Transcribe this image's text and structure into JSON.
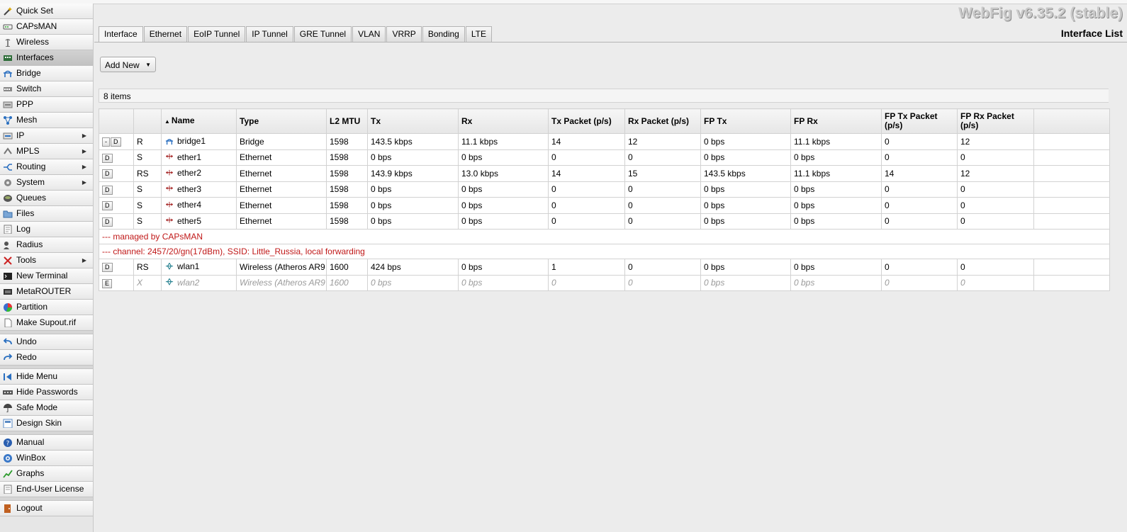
{
  "app": {
    "brand": "WebFig v6.35.2 (stable)",
    "page_title": "Interface List"
  },
  "sidebar": {
    "items": [
      {
        "label": "Quick Set",
        "icon": "wand-icon",
        "arrow": false
      },
      {
        "label": "CAPsMAN",
        "icon": "capsman-icon",
        "arrow": false
      },
      {
        "label": "Wireless",
        "icon": "antenna-icon",
        "arrow": false
      },
      {
        "label": "Interfaces",
        "icon": "interfaces-icon",
        "arrow": false
      },
      {
        "label": "Bridge",
        "icon": "bridge-icon",
        "arrow": false
      },
      {
        "label": "Switch",
        "icon": "switch-icon",
        "arrow": false
      },
      {
        "label": "PPP",
        "icon": "ppp-icon",
        "arrow": false
      },
      {
        "label": "Mesh",
        "icon": "mesh-icon",
        "arrow": false
      },
      {
        "label": "IP",
        "icon": "ip-icon",
        "arrow": true
      },
      {
        "label": "MPLS",
        "icon": "mpls-icon",
        "arrow": true
      },
      {
        "label": "Routing",
        "icon": "routing-icon",
        "arrow": true
      },
      {
        "label": "System",
        "icon": "gear-icon",
        "arrow": true
      },
      {
        "label": "Queues",
        "icon": "queues-icon",
        "arrow": false
      },
      {
        "label": "Files",
        "icon": "folder-icon",
        "arrow": false
      },
      {
        "label": "Log",
        "icon": "log-icon",
        "arrow": false
      },
      {
        "label": "Radius",
        "icon": "radius-icon",
        "arrow": false
      },
      {
        "label": "Tools",
        "icon": "tools-icon",
        "arrow": true
      },
      {
        "label": "New Terminal",
        "icon": "terminal-icon",
        "arrow": false
      },
      {
        "label": "MetaROUTER",
        "icon": "metarouter-icon",
        "arrow": false
      },
      {
        "label": "Partition",
        "icon": "partition-icon",
        "arrow": false
      },
      {
        "label": "Make Supout.rif",
        "icon": "document-icon",
        "arrow": false
      }
    ],
    "history": [
      {
        "label": "Undo",
        "icon": "undo-icon"
      },
      {
        "label": "Redo",
        "icon": "redo-icon"
      }
    ],
    "settings": [
      {
        "label": "Hide Menu",
        "icon": "hide-menu-icon"
      },
      {
        "label": "Hide Passwords",
        "icon": "password-dots-icon"
      },
      {
        "label": "Safe Mode",
        "icon": "umbrella-icon"
      },
      {
        "label": "Design Skin",
        "icon": "design-skin-icon"
      }
    ],
    "help": [
      {
        "label": "Manual",
        "icon": "help-icon"
      },
      {
        "label": "WinBox",
        "icon": "winbox-icon"
      },
      {
        "label": "Graphs",
        "icon": "graph-icon"
      },
      {
        "label": "End-User License",
        "icon": "license-icon"
      }
    ],
    "logout": {
      "label": "Logout",
      "icon": "logout-icon"
    }
  },
  "tabs": [
    "Interface",
    "Ethernet",
    "EoIP Tunnel",
    "IP Tunnel",
    "GRE Tunnel",
    "VLAN",
    "VRRP",
    "Bonding",
    "LTE"
  ],
  "toolbar": {
    "add_new_label": "Add New"
  },
  "list": {
    "count_text": "8 items",
    "columns": [
      "",
      "",
      "Name",
      "Type",
      "L2 MTU",
      "Tx",
      "Rx",
      "Tx Packet (p/s)",
      "Rx Packet (p/s)",
      "FP Tx",
      "FP Rx",
      "FP Tx Packet (p/s)",
      "FP Rx Packet (p/s)",
      ""
    ],
    "sorted_column": "Name",
    "rows": [
      {
        "kind": "data",
        "buttons": [
          "-",
          "D"
        ],
        "flags": "R",
        "icon": "bridge-icon",
        "name": "bridge1",
        "type": "Bridge",
        "l2mtu": "1598",
        "tx": "143.5 kbps",
        "rx": "11.1 kbps",
        "tx_pps": "14",
        "rx_pps": "12",
        "fp_tx": "0 bps",
        "fp_rx": "11.1 kbps",
        "fp_tx_pps": "0",
        "fp_rx_pps": "12"
      },
      {
        "kind": "data",
        "buttons": [
          "D"
        ],
        "flags": "S",
        "icon": "ethernet-icon",
        "name": "ether1",
        "type": "Ethernet",
        "l2mtu": "1598",
        "tx": "0 bps",
        "rx": "0 bps",
        "tx_pps": "0",
        "rx_pps": "0",
        "fp_tx": "0 bps",
        "fp_rx": "0 bps",
        "fp_tx_pps": "0",
        "fp_rx_pps": "0"
      },
      {
        "kind": "data",
        "buttons": [
          "D"
        ],
        "flags": "RS",
        "icon": "ethernet-icon",
        "name": "ether2",
        "type": "Ethernet",
        "l2mtu": "1598",
        "tx": "143.9 kbps",
        "rx": "13.0 kbps",
        "tx_pps": "14",
        "rx_pps": "15",
        "fp_tx": "143.5 kbps",
        "fp_rx": "11.1 kbps",
        "fp_tx_pps": "14",
        "fp_rx_pps": "12"
      },
      {
        "kind": "data",
        "buttons": [
          "D"
        ],
        "flags": "S",
        "icon": "ethernet-icon",
        "name": "ether3",
        "type": "Ethernet",
        "l2mtu": "1598",
        "tx": "0 bps",
        "rx": "0 bps",
        "tx_pps": "0",
        "rx_pps": "0",
        "fp_tx": "0 bps",
        "fp_rx": "0 bps",
        "fp_tx_pps": "0",
        "fp_rx_pps": "0"
      },
      {
        "kind": "data",
        "buttons": [
          "D"
        ],
        "flags": "S",
        "icon": "ethernet-icon",
        "name": "ether4",
        "type": "Ethernet",
        "l2mtu": "1598",
        "tx": "0 bps",
        "rx": "0 bps",
        "tx_pps": "0",
        "rx_pps": "0",
        "fp_tx": "0 bps",
        "fp_rx": "0 bps",
        "fp_tx_pps": "0",
        "fp_rx_pps": "0"
      },
      {
        "kind": "data",
        "buttons": [
          "D"
        ],
        "flags": "S",
        "icon": "ethernet-icon",
        "name": "ether5",
        "type": "Ethernet",
        "l2mtu": "1598",
        "tx": "0 bps",
        "rx": "0 bps",
        "tx_pps": "0",
        "rx_pps": "0",
        "fp_tx": "0 bps",
        "fp_rx": "0 bps",
        "fp_tx_pps": "0",
        "fp_rx_pps": "0"
      },
      {
        "kind": "comment",
        "text": "--- managed by CAPsMAN"
      },
      {
        "kind": "comment",
        "text": "--- channel: 2457/20/gn(17dBm), SSID: Little_Russia, local forwarding"
      },
      {
        "kind": "data",
        "buttons": [
          "D"
        ],
        "flags": "RS",
        "icon": "wireless-icon",
        "name": "wlan1",
        "type": "Wireless (Atheros AR9",
        "l2mtu": "1600",
        "tx": "424 bps",
        "rx": "0 bps",
        "tx_pps": "1",
        "rx_pps": "0",
        "fp_tx": "0 bps",
        "fp_rx": "0 bps",
        "fp_tx_pps": "0",
        "fp_rx_pps": "0"
      },
      {
        "kind": "data",
        "disabled": true,
        "buttons": [
          "E"
        ],
        "flags": "X",
        "icon": "wireless-icon",
        "name": "wlan2",
        "type": "Wireless (Atheros AR9",
        "l2mtu": "1600",
        "tx": "0 bps",
        "rx": "0 bps",
        "tx_pps": "0",
        "rx_pps": "0",
        "fp_tx": "0 bps",
        "fp_rx": "0 bps",
        "fp_tx_pps": "0",
        "fp_rx_pps": "0"
      }
    ]
  },
  "colors": {
    "comment_text": "#c01818",
    "disabled_text": "#9a9a9a",
    "brand_text": "#c9c9c9",
    "sidebar_bg": "#e6e6e6",
    "page_bg": "#ececec"
  }
}
